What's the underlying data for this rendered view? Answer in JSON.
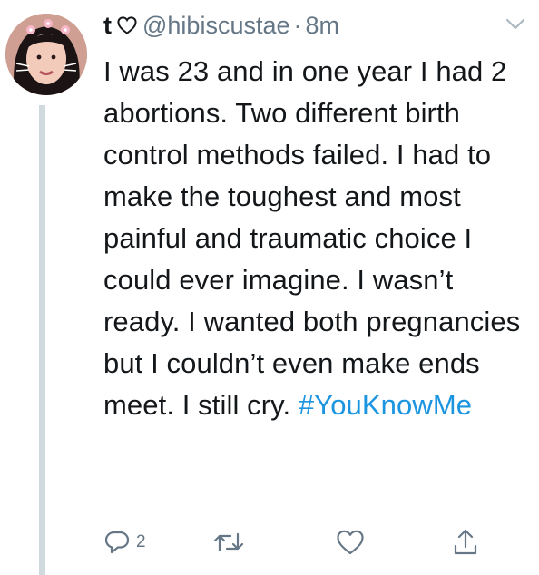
{
  "tweet": {
    "display_name": "t",
    "handle": "@hibiscustae",
    "separator": "·",
    "time": "8m",
    "text_before_tag": "I was 23 and in one year I had 2 abortions. Two different birth control methods failed. I had to make the toughest and most painful and traumatic choice I could ever imagine. I wasn’t ready. I wanted both pregnancies but I couldn’t even make ends meet. I still cry.",
    "hashtag": "#YouKnowMe"
  },
  "actions": {
    "reply_count": "2"
  },
  "icons": {
    "name_badge": "heart-outline-icon",
    "menu": "chevron-down-icon",
    "reply": "reply-icon",
    "retweet": "retweet-icon",
    "like": "heart-icon",
    "share": "share-icon"
  },
  "colors": {
    "text": "#14171a",
    "secondary": "#657786",
    "link": "#1b95e0",
    "thread_line": "#cfd9de"
  }
}
